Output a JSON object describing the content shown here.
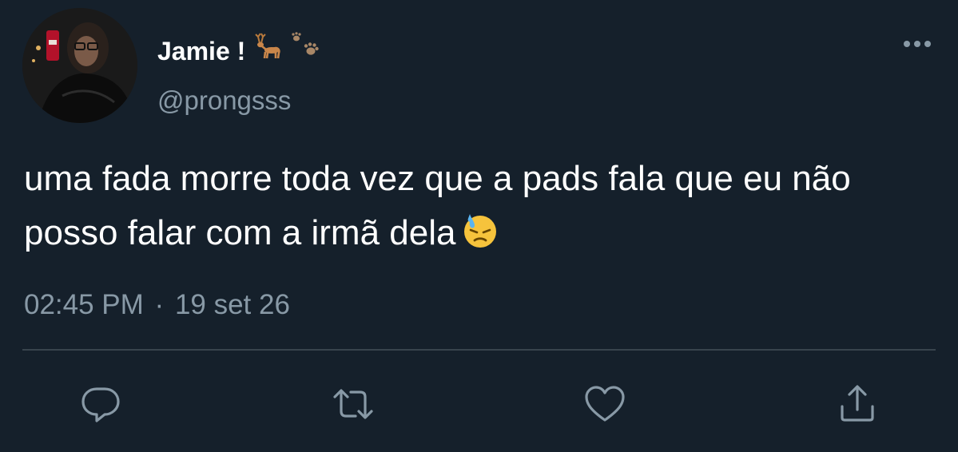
{
  "tweet": {
    "display_name": "Jamie !",
    "name_emojis": [
      "deer-emoji",
      "paw-prints-emoji"
    ],
    "handle": "@prongsss",
    "text": "uma fada morre toda vez que a pads fala que eu não posso falar com a irmã dela",
    "text_emoji": "downcast-face-with-sweat-emoji",
    "time": "02:45 PM",
    "separator": "·",
    "date": "19 set 26"
  },
  "actions": {
    "icons": [
      "reply-icon",
      "retweet-icon",
      "like-icon",
      "share-icon"
    ]
  },
  "colors": {
    "background": "#15202b",
    "primary_text": "#ffffff",
    "secondary_text": "#8899a6",
    "divider": "#38444d"
  }
}
